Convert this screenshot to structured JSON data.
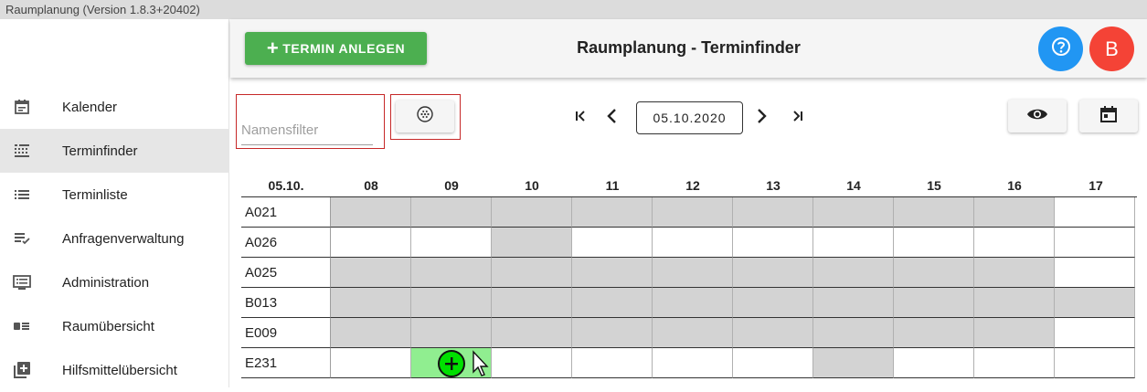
{
  "window": {
    "title": "Raumplanung (Version 1.8.3+20402)"
  },
  "sidebar": {
    "items": [
      {
        "label": "Kalender",
        "icon": "calendar-icon",
        "active": false
      },
      {
        "label": "Terminfinder",
        "icon": "grid-list-icon",
        "active": true
      },
      {
        "label": "Terminliste",
        "icon": "list-icon",
        "active": false
      },
      {
        "label": "Anfragenverwaltung",
        "icon": "playlist-check-icon",
        "active": false
      },
      {
        "label": "Administration",
        "icon": "admin-list-icon",
        "active": false
      },
      {
        "label": "Raumübersicht",
        "icon": "room-card-icon",
        "active": false
      },
      {
        "label": "Hilfsmittelübersicht",
        "icon": "library-add-icon",
        "active": false
      }
    ]
  },
  "appbar": {
    "new_button_label": "TERMIN ANLEGEN",
    "title": "Raumplanung - Terminfinder",
    "help_icon": "help-circle-icon",
    "user_initial": "B",
    "colors": {
      "new": "#4caf50",
      "help": "#2196f3",
      "user": "#f44336"
    }
  },
  "filter": {
    "placeholder": "Namensfilter",
    "value": ""
  },
  "navigation": {
    "date": "05.10.2020"
  },
  "schedule": {
    "date_label": "05.10.",
    "hours": [
      "08",
      "09",
      "10",
      "11",
      "12",
      "13",
      "14",
      "15",
      "16",
      "17"
    ],
    "rooms": [
      {
        "name": "A021",
        "slots": [
          "busy",
          "busy",
          "busy",
          "busy",
          "busy",
          "busy",
          "busy",
          "busy",
          "busy",
          "free"
        ]
      },
      {
        "name": "A026",
        "slots": [
          "free",
          "free",
          "busy",
          "free",
          "free",
          "free",
          "free",
          "free",
          "free",
          "free"
        ]
      },
      {
        "name": "A025",
        "slots": [
          "busy",
          "busy",
          "busy",
          "busy",
          "busy",
          "busy",
          "busy",
          "busy",
          "busy",
          "free"
        ]
      },
      {
        "name": "B013",
        "slots": [
          "busy",
          "busy",
          "busy",
          "busy",
          "busy",
          "busy",
          "busy",
          "busy",
          "busy",
          "busy"
        ]
      },
      {
        "name": "E009",
        "slots": [
          "busy",
          "busy",
          "busy",
          "busy",
          "busy",
          "busy",
          "busy",
          "busy",
          "busy",
          "free"
        ]
      },
      {
        "name": "E231",
        "slots": [
          "free",
          "selected",
          "free",
          "free",
          "free",
          "free",
          "busy",
          "free",
          "free",
          "free"
        ]
      }
    ]
  }
}
